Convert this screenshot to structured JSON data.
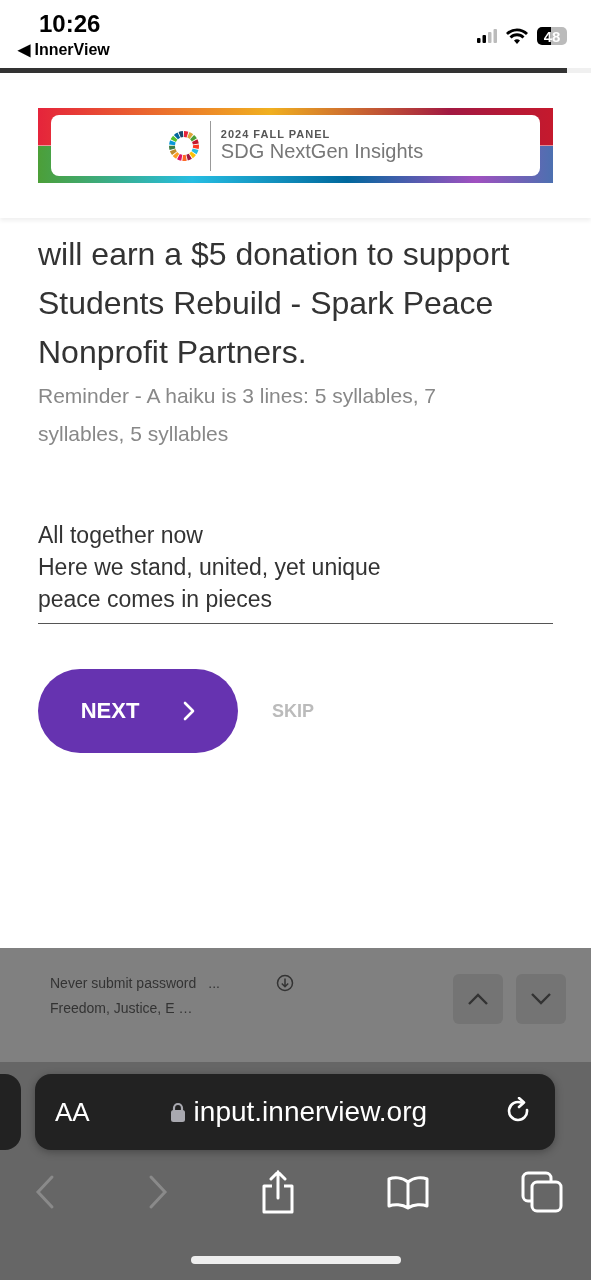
{
  "status_bar": {
    "time": "10:26",
    "back_app": "◀ InnerView",
    "battery": "48"
  },
  "progress": {
    "level": 0.96
  },
  "banner": {
    "eyebrow": "2024 FALL PANEL",
    "title": "SDG NextGen Insights"
  },
  "question": {
    "text": "will earn a $5 donation to support Students Rebuild - Spark Peace Nonprofit Partners.",
    "reminder": "Reminder - A haiku is 3 lines: 5 syllables, 7 syllables, 5 syllables"
  },
  "answer": {
    "value": "All together now\nHere we stand, united, yet unique\npeace comes in pieces"
  },
  "buttons": {
    "next": "NEXT",
    "skip": "SKIP"
  },
  "autofill": {
    "suggestions": [
      "Never submit password",
      "Freedom, Justice, E …"
    ],
    "more": "..."
  },
  "browser": {
    "text_size": "AA",
    "url": "input.innerview.org"
  }
}
